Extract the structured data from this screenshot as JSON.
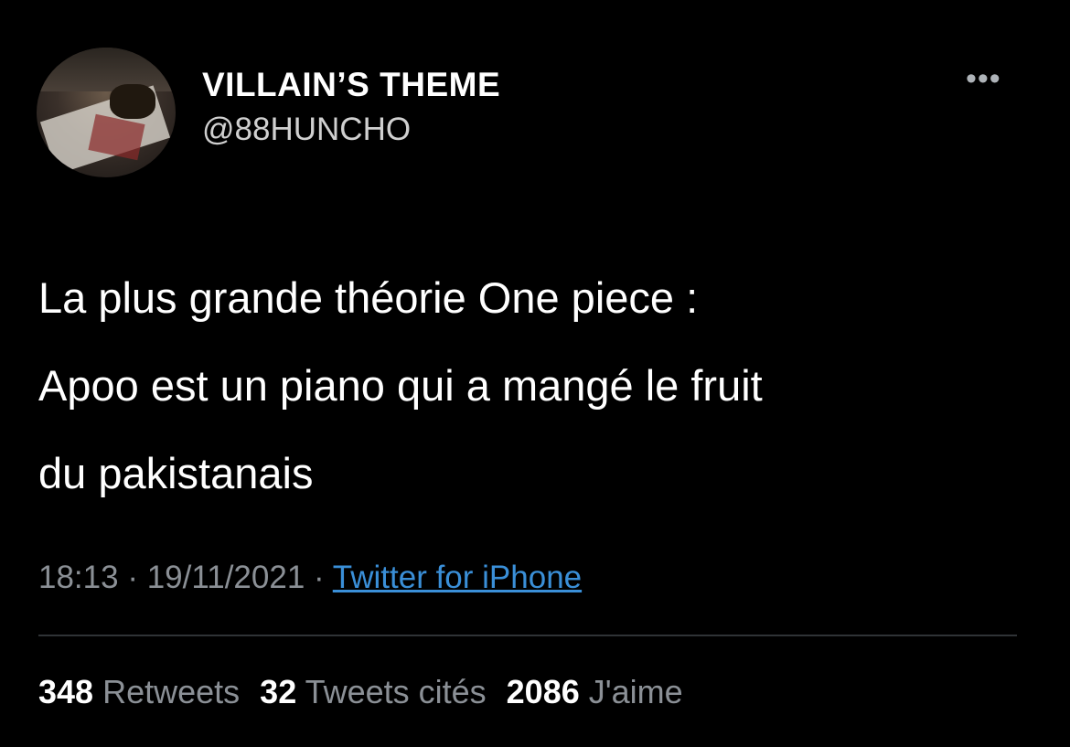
{
  "author": {
    "display_name": "VILLAIN’S THEME",
    "handle": "@88HUNCHO",
    "more_icon": "more-horizontal-icon"
  },
  "tweet": {
    "lines": [
      "La plus grande théorie One piece :",
      "Apoo est un piano qui a mangé le fruit",
      "du pakistanais"
    ],
    "time": "18:13",
    "date": "19/11/2021",
    "separator": "·",
    "source": "Twitter for iPhone"
  },
  "stats": {
    "retweets_count": "348",
    "retweets_label": "Retweets",
    "quotes_count": "32",
    "quotes_label": "Tweets cités",
    "likes_count": "2086",
    "likes_label": "J'aime"
  },
  "colors": {
    "background": "#000000",
    "text": "#ffffff",
    "secondary": "#8b9096",
    "link": "#3a8fd8"
  }
}
